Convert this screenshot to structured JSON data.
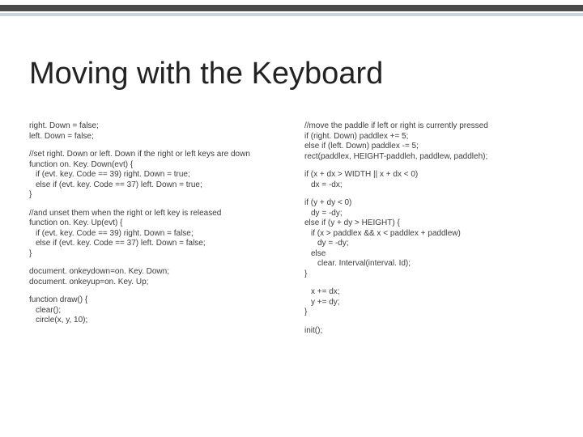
{
  "title": "Moving with the Keyboard",
  "left": {
    "b1": {
      "l1": "right. Down = false;",
      "l2": "left. Down = false;"
    },
    "b2": {
      "l1": "//set right. Down or left. Down if the right or left keys are down",
      "l2": "function on. Key. Down(evt) {",
      "l3": "if (evt. key. Code == 39) right. Down = true;",
      "l4": "else if (evt. key. Code == 37) left. Down = true;",
      "l5": "}"
    },
    "b3": {
      "l1": "//and unset them when the right or left key is released",
      "l2": "function on. Key. Up(evt) {",
      "l3": "if (evt. key. Code == 39) right. Down = false;",
      "l4": "else if (evt. key. Code == 37) left. Down = false;",
      "l5": "}"
    },
    "b4": {
      "l1": "document. onkeydown=on. Key. Down;",
      "l2": "document. onkeyup=on. Key. Up;"
    },
    "b5": {
      "l1": "function draw() {",
      "l2": "clear();",
      "l3": "circle(x, y, 10);"
    }
  },
  "right": {
    "b1": {
      "l1": "//move the paddle if left or right is currently pressed",
      "l2": "if (right. Down) paddlex += 5;",
      "l3": "else if (left. Down) paddlex -= 5;",
      "l4": "rect(paddlex, HEIGHT-paddleh, paddlew, paddleh);"
    },
    "b2": {
      "l1": "if (x + dx > WIDTH || x + dx < 0)",
      "l2": "dx = -dx;"
    },
    "b3": {
      "l1": "if (y + dy < 0)",
      "l2": "dy = -dy;",
      "l3": "else if (y + dy > HEIGHT) {",
      "l4": "if (x > paddlex && x < paddlex + paddlew)",
      "l5": "dy = -dy;",
      "l6": "else",
      "l7": "clear. Interval(interval. Id);",
      "l8": "}"
    },
    "b4": {
      "l1": "x += dx;",
      "l2": "y += dy;",
      "l3": "}"
    },
    "b5": {
      "l1": "init();"
    }
  }
}
